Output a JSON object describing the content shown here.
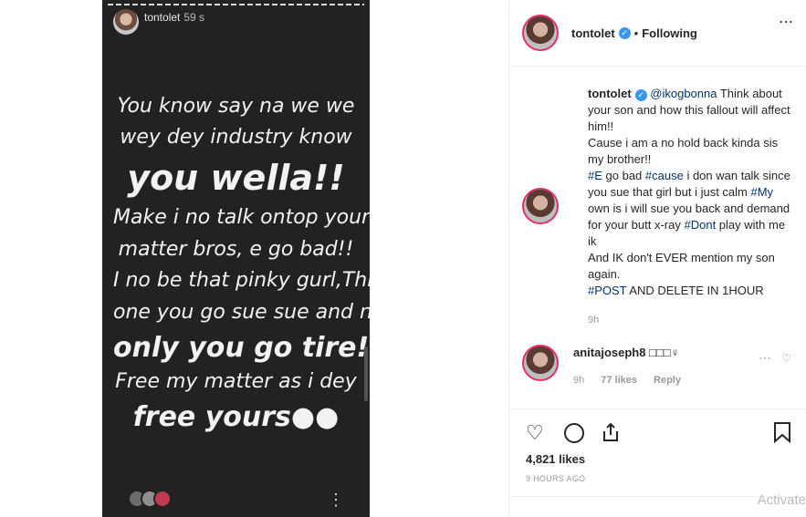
{
  "story": {
    "username": "tontolet",
    "time": "59 s",
    "lines": [
      "You know say na we we",
      "wey dey industry know",
      "you wella!!",
      "Make i no talk ontop your",
      "matter bros, e go bad!!",
      "I no be that pinky gurl,This",
      "one you go sue sue and na",
      "only you go tire!!",
      "Free my matter as i dey",
      "free yours●●"
    ],
    "more_icon": "more-vertical-icon"
  },
  "post": {
    "username": "tontolet",
    "follow_status": "Following",
    "verified_icon": "verified-icon",
    "more_icon": "more-horizontal-icon"
  },
  "caption": {
    "username": "tontolet",
    "mention": "@ikogbonna",
    "p1": " Think about your son and how this fallout will affect him!!",
    "p2": "Cause i am a no hold back kinda sis my brother!!",
    "tag_e": "#E",
    "p3a": " go bad ",
    "tag_cause": "#cause",
    "p3b": " i don wan talk since you sue that girl but i just calm ",
    "tag_my": "#My",
    "p3c": " own is i will sue you back and demand for your butt x-ray ",
    "tag_dont": "#Dont",
    "p3d": " play with me ik",
    "p4": "And IK don't EVER mention my son again.",
    "tag_post": "#POST",
    "p5": " AND DELETE IN 1HOUR",
    "time": "9h"
  },
  "comment": {
    "username": "anitajoseph8",
    "text": "□□□♀",
    "time": "9h",
    "likes": "77 likes",
    "reply": "Reply"
  },
  "actions": {
    "like_icon": "heart-icon",
    "comment_icon": "comment-icon",
    "share_icon": "share-icon",
    "save_icon": "bookmark-icon"
  },
  "likes_total": "4,821 likes",
  "age": "9 HOURS AGO",
  "watermark": "Activate"
}
